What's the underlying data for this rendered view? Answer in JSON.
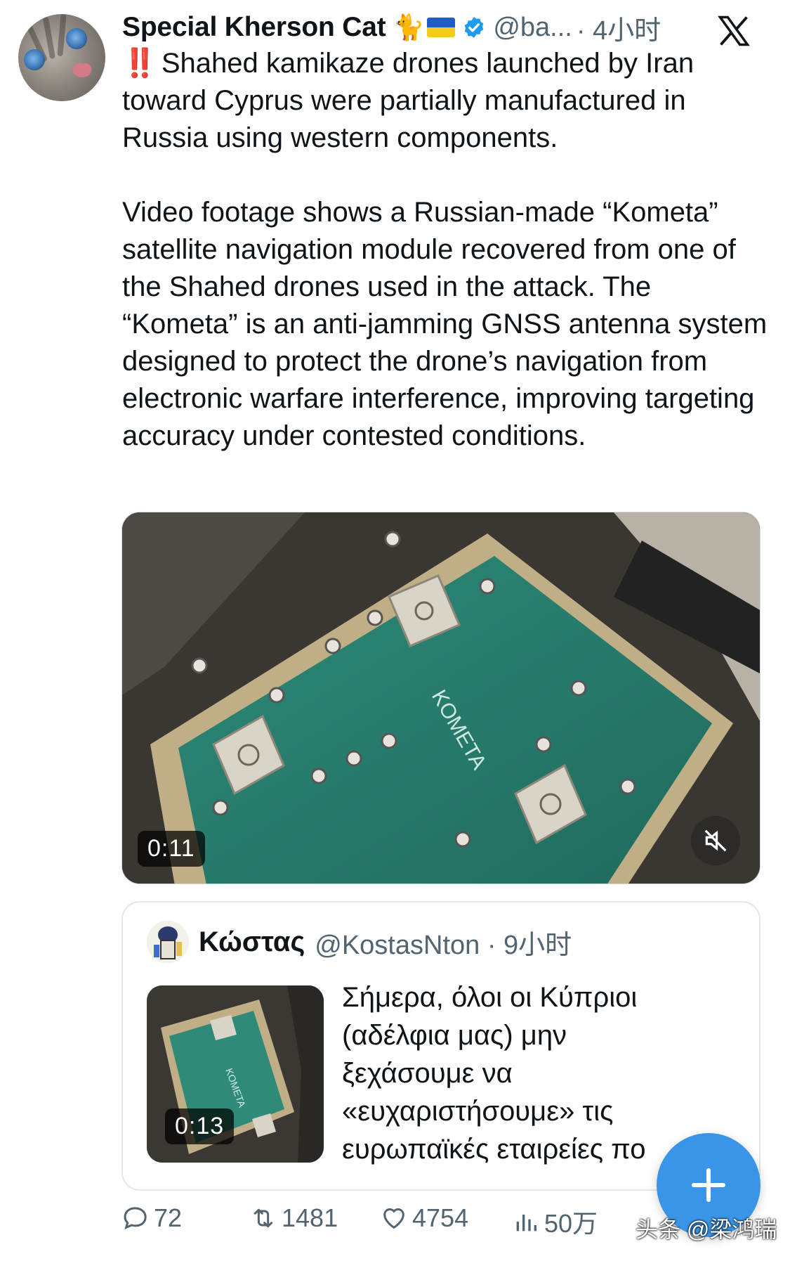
{
  "author": {
    "name": "Special Kherson Cat",
    "emoji": "🐈",
    "handle": "@ba...",
    "time": "· 4小时"
  },
  "tweet": {
    "bangs": "‼️",
    "paragraph1": "Shahed kamikaze drones launched by Iran toward Cyprus were partially manufactured in Russia using western components.",
    "paragraph2": "Video footage shows a Russian-made “Kometa” satellite navigation module recovered from one of the Shahed drones used in the attack. The “Kometa” is an anti-jamming GNSS antenna system designed to protect the drone’s navigation from electronic warfare interference, improving targeting accuracy under contested conditions."
  },
  "media": {
    "duration": "0:11",
    "board_label": "KOMETA",
    "mute_icon": "speaker-muted-icon"
  },
  "quote": {
    "name": "Κώστας",
    "handle": "@KostasNton · 9小时",
    "thumb_duration": "0:13",
    "thumb_label": "KOMETA",
    "lines": [
      "Σήμερα, όλοι οι Κύπριοι",
      "(αδέλφια μας) μην",
      "ξεχάσουμε να",
      "«ευχαριστήσουμε» τις",
      "ευρωπαϊκές εταιρείες πο"
    ]
  },
  "actions": {
    "replies": "72",
    "retweets": "1481",
    "likes": "4754",
    "views": "50万"
  },
  "watermark": "头条 @梁鸿瑞",
  "colors": {
    "verified": "#1d9bf0",
    "fab": "#3a95e8",
    "muted_text": "#536471",
    "bangs": "#e02424"
  }
}
